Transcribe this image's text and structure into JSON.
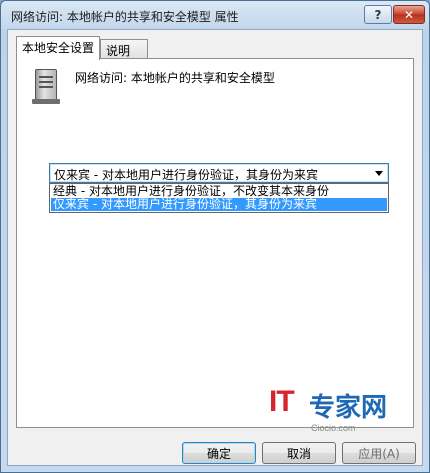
{
  "window": {
    "title": "网络访问: 本地帐户的共享和安全模型 属性",
    "help_label": "?",
    "close_label": "✕"
  },
  "tabs": [
    {
      "label": "本地安全设置",
      "active": true
    },
    {
      "label": "说明",
      "active": false
    }
  ],
  "policy": {
    "icon": "server-icon",
    "title": "网络访问: 本地帐户的共享和安全模型"
  },
  "combo": {
    "selected": "仅来宾 - 对本地用户进行身份验证，其身份为来宾",
    "options": [
      "经典 - 对本地用户进行身份验证，不改变其本来身份",
      "仅来宾 - 对本地用户进行身份验证，其身份为来宾"
    ],
    "highlighted_index": 1
  },
  "buttons": {
    "ok": "确定",
    "cancel": "取消",
    "apply": "应用(A)"
  },
  "watermark": {
    "brand": "IT",
    "name": "专家网",
    "sub": "Ciocio.com"
  },
  "colors": {
    "selection": "#3399ff",
    "watermark_red": "#d6262b",
    "watermark_blue": "#1f68b4"
  }
}
